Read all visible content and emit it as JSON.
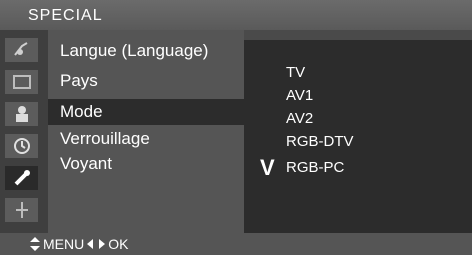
{
  "title": "SPECIAL",
  "icons": [
    "satellite-dish-icon",
    "screen-icon",
    "lock-person-icon",
    "clock-icon",
    "tools-icon",
    "plug-icon"
  ],
  "menu": {
    "items": [
      {
        "label": "Langue (Language)"
      },
      {
        "label": "Pays"
      },
      {
        "label": "Mode",
        "selected": true
      },
      {
        "label": "Verrouillage"
      },
      {
        "label": "Voyant"
      }
    ]
  },
  "mode_options": {
    "options": [
      "TV",
      "AV1",
      "AV2",
      "RGB-DTV",
      "RGB-PC"
    ],
    "selected": "RGB-PC",
    "check_mark": "V"
  },
  "footer": {
    "menu_label": "MENU",
    "ok_label": "OK"
  }
}
